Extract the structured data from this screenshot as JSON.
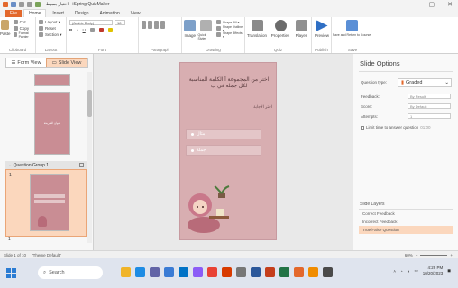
{
  "window": {
    "title": "اختبار بسيط - iSpring QuizMaker",
    "controls": {
      "minimize": "—",
      "maximize": "▢",
      "close": "✕"
    }
  },
  "ribbon": {
    "tabs": [
      {
        "label": "File",
        "kind": "file"
      },
      {
        "label": "Home",
        "kind": "active"
      },
      {
        "label": "Insert",
        "kind": ""
      },
      {
        "label": "Design",
        "kind": ""
      },
      {
        "label": "Animation",
        "kind": ""
      },
      {
        "label": "View",
        "kind": ""
      }
    ],
    "clipboard": {
      "paste": "Paste",
      "cut": "Cut",
      "copy": "Copy",
      "format_painter": "Format Painter",
      "label": "Clipboard"
    },
    "layout": {
      "layout_btn": "Layout ▾",
      "reset": "Reset",
      "section": "Section ▾",
      "label": "Layout"
    },
    "font": {
      "font_name": "(Arabic Body)",
      "font_size": "18",
      "bold": "B",
      "italic": "I",
      "underline": "U",
      "label": "Font"
    },
    "paragraph": {
      "label": "Paragraph"
    },
    "drawing": {
      "image": "Image",
      "quick_styles": "Quick Styles",
      "shape_fill": "Shape Fill ▾",
      "shape_outline": "Shape Outline ▾",
      "shape_effects": "Shape Effects ▾",
      "label": "Drawing"
    },
    "quiz": {
      "translation": "Translation",
      "properties": "Properties",
      "player": "Player",
      "label": "Quiz"
    },
    "publish": {
      "preview": "Preview",
      "label": "Publish"
    },
    "save": {
      "save_close": "Save and Return to Course",
      "label": "Save"
    }
  },
  "left_panel": {
    "form_view": "Form View",
    "slide_view": "Slide View",
    "slide_title": "عنوان الشريحة",
    "question_group": "Question Group 1",
    "slide_number": "1",
    "bottom_group": "1"
  },
  "slide": {
    "question": "اختر من المجموعة أ الكلمة المناسبة لكل جملة في ب",
    "select_label": "اختر الإجابة",
    "choices": [
      "مثال",
      "جملة"
    ]
  },
  "right_panel": {
    "title": "Slide Options",
    "question_type_label": "Question type:",
    "question_type_value": "Graded",
    "feedback_label": "Feedback:",
    "feedback_value": "By Result",
    "score_label": "Score:",
    "score_value": "By Default",
    "attempts_label": "Attempts:",
    "attempts_value": "1",
    "time_limit_label": "Limit time to answer question",
    "time_limit_value": "01:00",
    "slide_layers_label": "Slide Layers",
    "layers": [
      {
        "label": "Correct Feedback",
        "selected": false
      },
      {
        "label": "Incorrect Feedback",
        "selected": false
      },
      {
        "label": "True/False Question",
        "selected": true
      }
    ]
  },
  "statusbar": {
    "slide_info": "Slide 1 of 10",
    "theme": "\"Theme Default\"",
    "zoom": "60%"
  },
  "taskbar": {
    "search_placeholder": "Search",
    "time": "4:29 PM",
    "date": "10/20/2023",
    "apps": [
      "file-explorer",
      "edge",
      "teams",
      "store",
      "mail",
      "photos",
      "chrome",
      "office",
      "settings",
      "word",
      "powerpoint",
      "excel",
      "quizmaker",
      "vlc",
      "calculator"
    ]
  },
  "colors": {
    "accent": "#e3682c",
    "selection": "#fbd7bd",
    "slide_bg": "#d8aeb1",
    "choice_bg": "#e4c6c8"
  }
}
